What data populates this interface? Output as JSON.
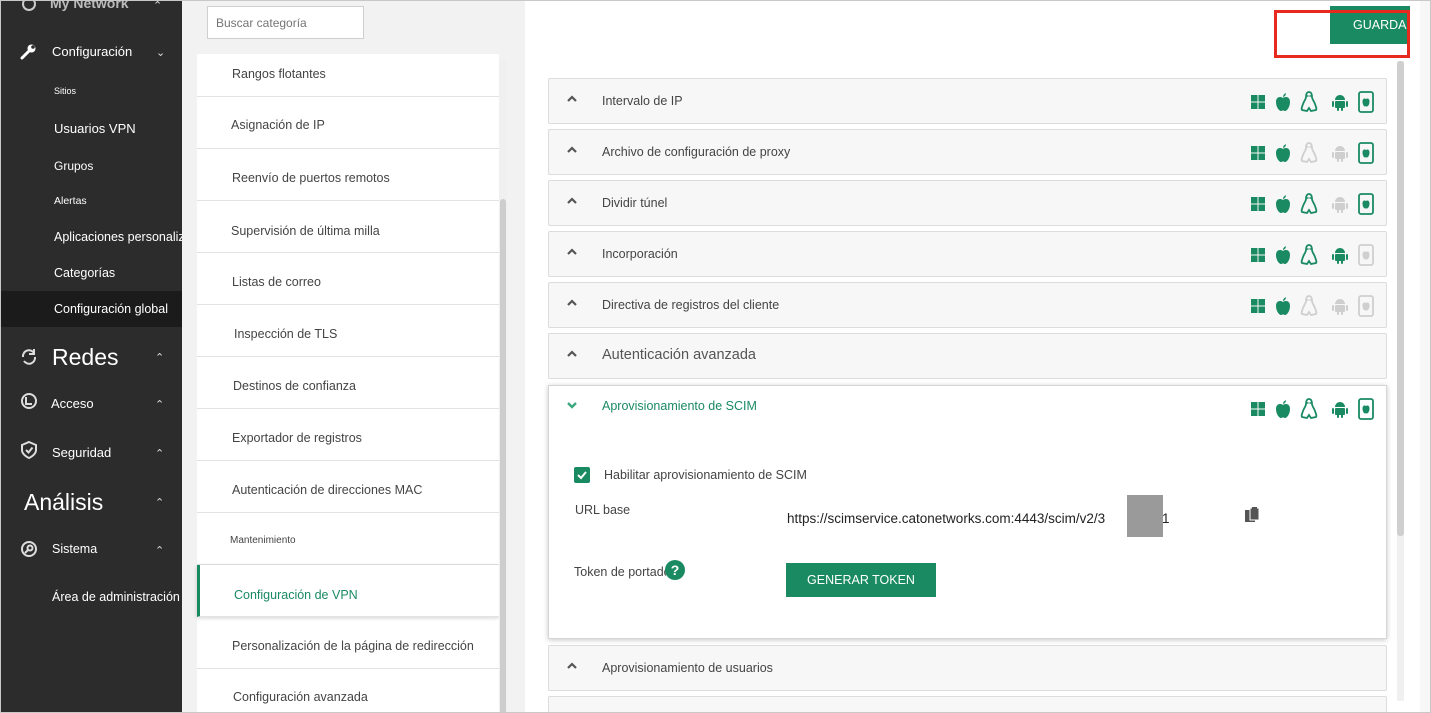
{
  "nav": {
    "my_network": "My Network",
    "configuracion": "Configuración",
    "sub_items": [
      "Sitios",
      "Usuarios VPN",
      "Grupos",
      "Alertas",
      "Aplicaciones personalizadas",
      "Categorías",
      "Configuración global"
    ],
    "redes": "Redes",
    "acceso": "Acceso",
    "seguridad": "Seguridad",
    "analisis": "Análisis",
    "sistema": "Sistema",
    "area_admin": "Área de administración"
  },
  "categories": {
    "search_placeholder": "Buscar categoría",
    "items": [
      "Rangos flotantes",
      "Asignación de IP",
      "Reenvío de puertos remotos",
      "Supervisión de última milla",
      "Listas de correo",
      "Inspección de TLS",
      "Destinos de confianza",
      "Exportador de registros",
      "Autenticación de direcciones MAC",
      "Mantenimiento",
      "Configuración de VPN",
      "Personalización de la página de redirección",
      "Configuración avanzada"
    ],
    "active": "Configuración de VPN"
  },
  "toolbar": {
    "save_label": "GUARDAR"
  },
  "sections": [
    {
      "title": "Intervalo de IP",
      "os": [
        true,
        true,
        true,
        true,
        true
      ]
    },
    {
      "title": "Archivo de configuración de proxy",
      "os": [
        true,
        true,
        false,
        false,
        true
      ]
    },
    {
      "title": "Dividir túnel",
      "os": [
        true,
        true,
        true,
        false,
        true
      ]
    },
    {
      "title": "Incorporación",
      "os": [
        true,
        true,
        true,
        true,
        false
      ]
    },
    {
      "title": "Directiva de registros del cliente",
      "os": [
        true,
        true,
        false,
        false,
        false
      ]
    },
    {
      "title": "Autenticación avanzada",
      "os": []
    }
  ],
  "scim": {
    "title": "Aprovisionamiento de SCIM",
    "enable_label": "Habilitar aprovisionamiento de SCIM",
    "base_url_label": "URL base",
    "base_url_value": "https://scimservice.catonetworks.com:4443/scim/v2/3",
    "base_url_tail": "1",
    "token_label": "Token de portador",
    "help": "?",
    "generate_label": "GENERAR TOKEN"
  },
  "after_sections": [
    "Aprovisionamiento de usuarios"
  ],
  "colors": {
    "accent": "#1a8a63",
    "nav_bg": "#2c2c2c",
    "highlight": "#e8291d",
    "disabled_icon": "#cfcfcf"
  }
}
